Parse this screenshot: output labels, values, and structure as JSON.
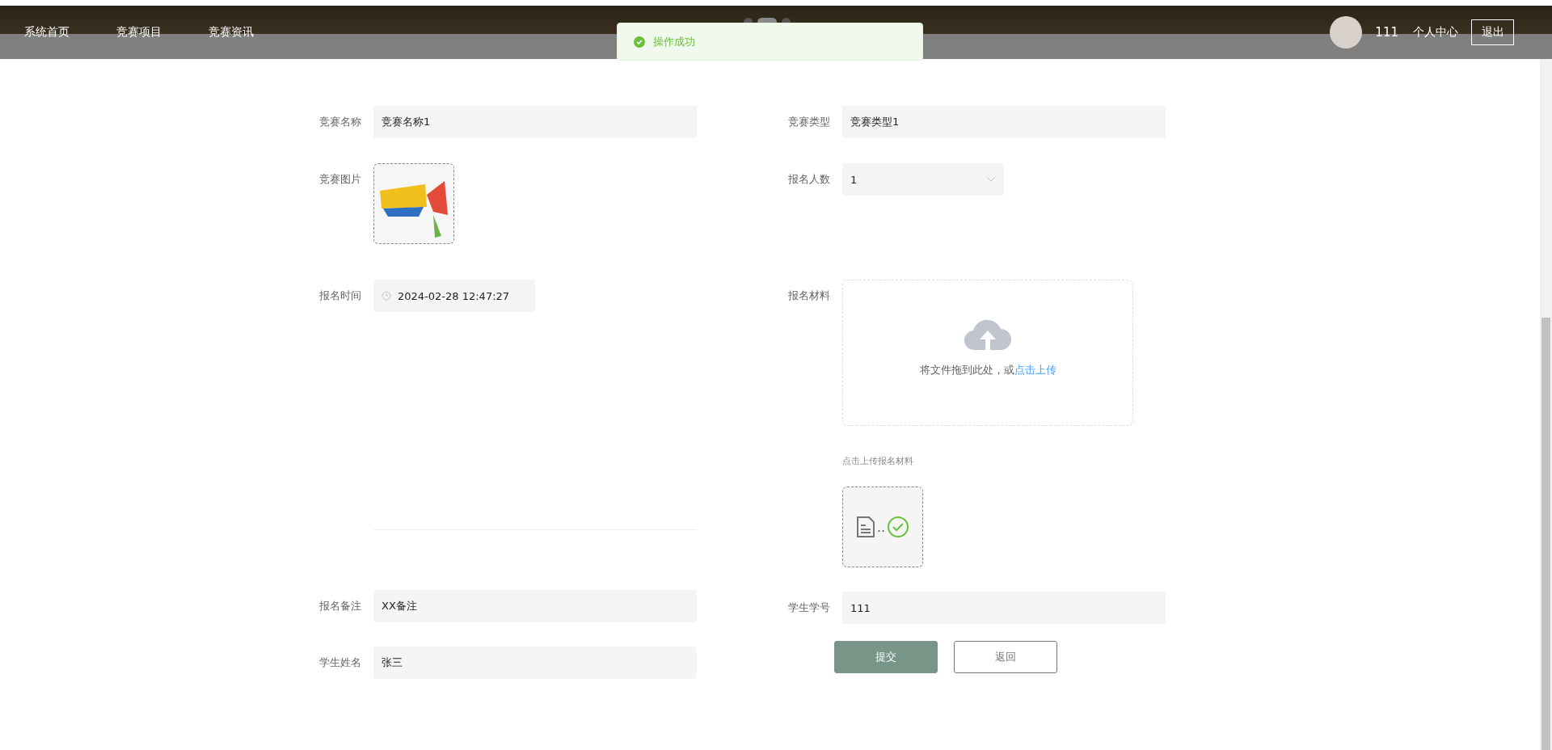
{
  "nav": {
    "items": [
      {
        "label": "系统首页"
      },
      {
        "label": "竞赛项目"
      },
      {
        "label": "竞赛资讯"
      }
    ]
  },
  "carousel": {
    "dots": [
      {
        "selected": false
      },
      {
        "selected": true
      },
      {
        "selected": false
      }
    ]
  },
  "toast": {
    "message": "操作成功"
  },
  "user": {
    "name": "111",
    "center": "个人中心",
    "logout": "退出"
  },
  "form": {
    "left": [
      {
        "kind": "text",
        "label": "竞赛名称",
        "value": "竞赛名称1"
      },
      {
        "kind": "image",
        "label": "竞赛图片"
      },
      {
        "kind": "datetime",
        "label": "报名时间",
        "value": "2024-02-28 12:47:27"
      },
      {
        "kind": "editor"
      },
      {
        "kind": "text",
        "label": "报名备注",
        "value": "XX备注"
      },
      {
        "kind": "text",
        "label": "学生姓名",
        "value": "张三"
      }
    ],
    "right": [
      {
        "kind": "text",
        "label": "竞赛类型",
        "value": "竞赛类型1"
      },
      {
        "kind": "select",
        "label": "报名人数",
        "value": "1"
      },
      {
        "kind": "upload",
        "label": "报名材料",
        "hint": "将文件拖到此处，或",
        "link": "点击上传"
      },
      {
        "kind": "tip",
        "text": "点击上传报名材料"
      },
      {
        "kind": "file",
        "name": "..",
        "uploaded": true
      },
      {
        "kind": "text",
        "label": "学生学号",
        "value": "111"
      },
      {
        "kind": "buttons",
        "buttons": [
          {
            "label": "提交",
            "kind": "primary"
          },
          {
            "label": "返回",
            "kind": "plain"
          }
        ]
      }
    ]
  }
}
